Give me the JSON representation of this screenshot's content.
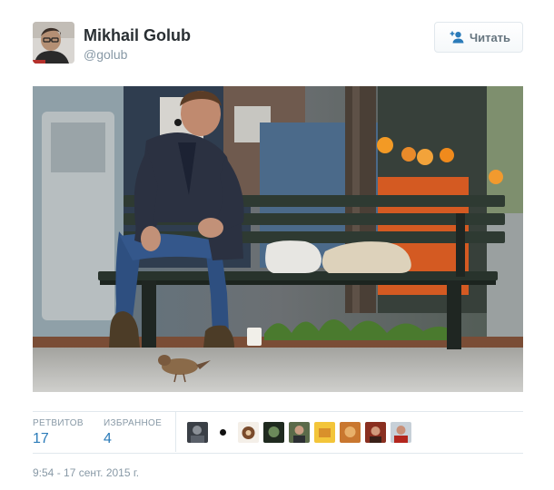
{
  "author": {
    "name": "Mikhail Golub",
    "handle": "@golub"
  },
  "follow_button": {
    "label": "Читать",
    "icon": "add-user-icon"
  },
  "stats": {
    "retweets_label": "РЕТВИТОВ",
    "retweets_count": "17",
    "favorites_label": "ИЗБРАННОЕ",
    "favorites_count": "4"
  },
  "timestamp": "9:54 - 17 сент. 2015 г.",
  "colors": {
    "link": "#2b7bb9",
    "muted": "#8899a6",
    "border": "#e1e8ed"
  }
}
